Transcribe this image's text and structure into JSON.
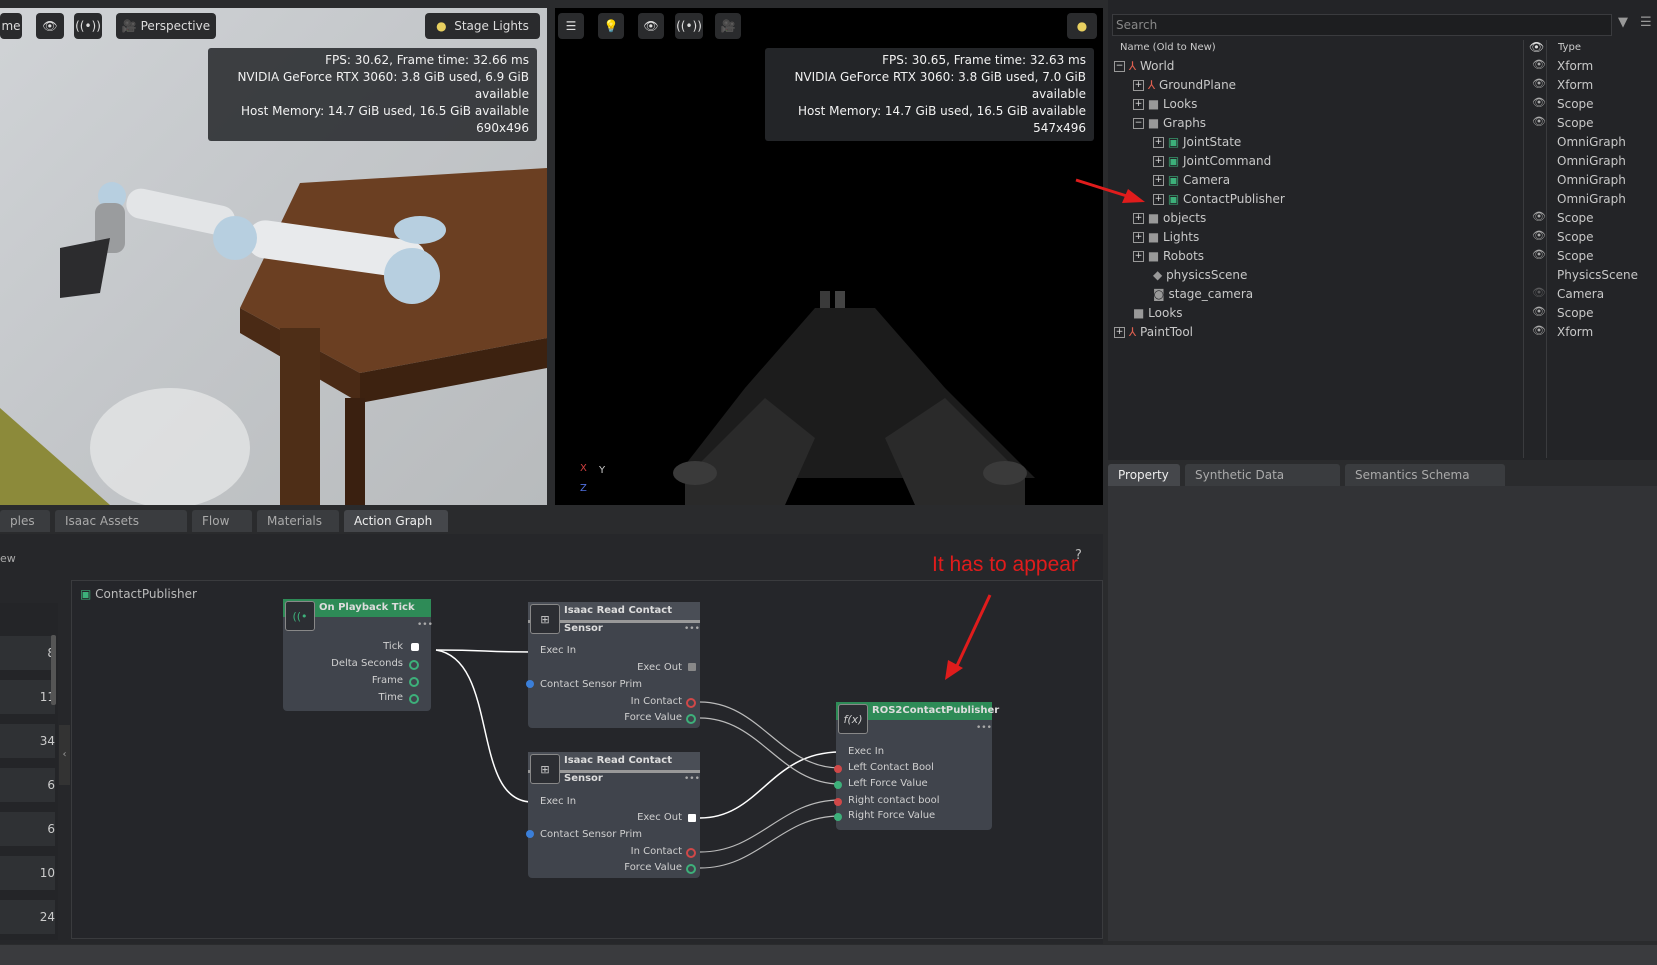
{
  "viewport_left": {
    "cut_label": "me",
    "camera": "Perspective",
    "lights": "Stage Lights",
    "stats": [
      "FPS: 30.62, Frame time: 32.66 ms",
      "NVIDIA GeForce RTX 3060: 3.8 GiB used, 6.9 GiB available",
      "Host Memory: 14.7 GiB used, 16.5 GiB available",
      "690x496"
    ]
  },
  "viewport_right": {
    "stats": [
      "FPS: 30.65, Frame time: 32.63 ms",
      "NVIDIA GeForce RTX 3060: 3.8 GiB used, 7.0 GiB available",
      "Host Memory: 14.7 GiB used, 16.5 GiB available",
      "547x496"
    ],
    "axes": {
      "x": "X",
      "y": "Y",
      "z": "Z"
    }
  },
  "bottom_tabs": [
    {
      "label": "ples",
      "active": false
    },
    {
      "label": "Isaac Assets (Beta)",
      "active": false
    },
    {
      "label": "Flow",
      "active": false
    },
    {
      "label": "Materials",
      "active": false
    },
    {
      "label": "Action Graph",
      "active": true
    }
  ],
  "graph": {
    "left_cut_label": "ew",
    "help": "?",
    "title": "ContactPublisher",
    "annotation": "It has to appear",
    "row_numbers": [
      "8",
      "11",
      "34",
      "6",
      "6",
      "10",
      "24"
    ],
    "tick_node": {
      "title": "On Playback Tick",
      "ports": [
        "Tick",
        "Delta Seconds",
        "Frame",
        "Time"
      ]
    },
    "sensor1": {
      "title": "Isaac Read Contact Sensor",
      "ports": [
        "Exec In",
        "Exec Out",
        "Contact Sensor Prim",
        "In Contact",
        "Force Value"
      ]
    },
    "sensor2": {
      "title": "Isaac Read Contact Sensor",
      "ports": [
        "Exec In",
        "Exec Out",
        "Contact Sensor Prim",
        "In Contact",
        "Force Value"
      ]
    },
    "publisher": {
      "title": "ROS2ContactPublisher",
      "ports": [
        "Exec In",
        "Left Contact Bool",
        "Left Force Value",
        "Right contact bool",
        "Right Force Value"
      ]
    }
  },
  "stage": {
    "search_placeholder": "Search",
    "col_name": "Name (Old to New)",
    "col_type": "Type",
    "rows": [
      {
        "name": "World",
        "type": "Xform",
        "exp": "−",
        "eye": true
      },
      {
        "name": "GroundPlane",
        "type": "Xform",
        "exp": "+",
        "eye": true
      },
      {
        "name": "Looks",
        "type": "Scope",
        "exp": "+",
        "eye": true
      },
      {
        "name": "Graphs",
        "type": "Scope",
        "exp": "−",
        "eye": true
      },
      {
        "name": "JointState",
        "type": "OmniGraph",
        "exp": "+",
        "eye": false
      },
      {
        "name": "JointCommand",
        "type": "OmniGraph",
        "exp": "+",
        "eye": false
      },
      {
        "name": "Camera",
        "type": "OmniGraph",
        "exp": "+",
        "eye": false
      },
      {
        "name": "ContactPublisher",
        "type": "OmniGraph",
        "exp": "+",
        "eye": false
      },
      {
        "name": "objects",
        "type": "Scope",
        "exp": "+",
        "eye": true
      },
      {
        "name": "Lights",
        "type": "Scope",
        "exp": "+",
        "eye": true
      },
      {
        "name": "Robots",
        "type": "Scope",
        "exp": "+",
        "eye": true
      },
      {
        "name": "physicsScene",
        "type": "PhysicsScene",
        "exp": "",
        "eye": false
      },
      {
        "name": "stage_camera",
        "type": "Camera",
        "exp": "",
        "eye": true
      },
      {
        "name": "Looks",
        "type": "Scope",
        "exp": "",
        "eye": true
      },
      {
        "name": "PaintTool",
        "type": "Xform",
        "exp": "+",
        "eye": true
      }
    ]
  },
  "property_tabs": [
    {
      "label": "Property",
      "active": true
    },
    {
      "label": "Synthetic Data Recorder",
      "active": false
    },
    {
      "label": "Semantics Schema Editor",
      "active": false
    }
  ],
  "colors": {
    "accent_green": "#2e8b57",
    "arrow_red": "#e01c1c"
  }
}
